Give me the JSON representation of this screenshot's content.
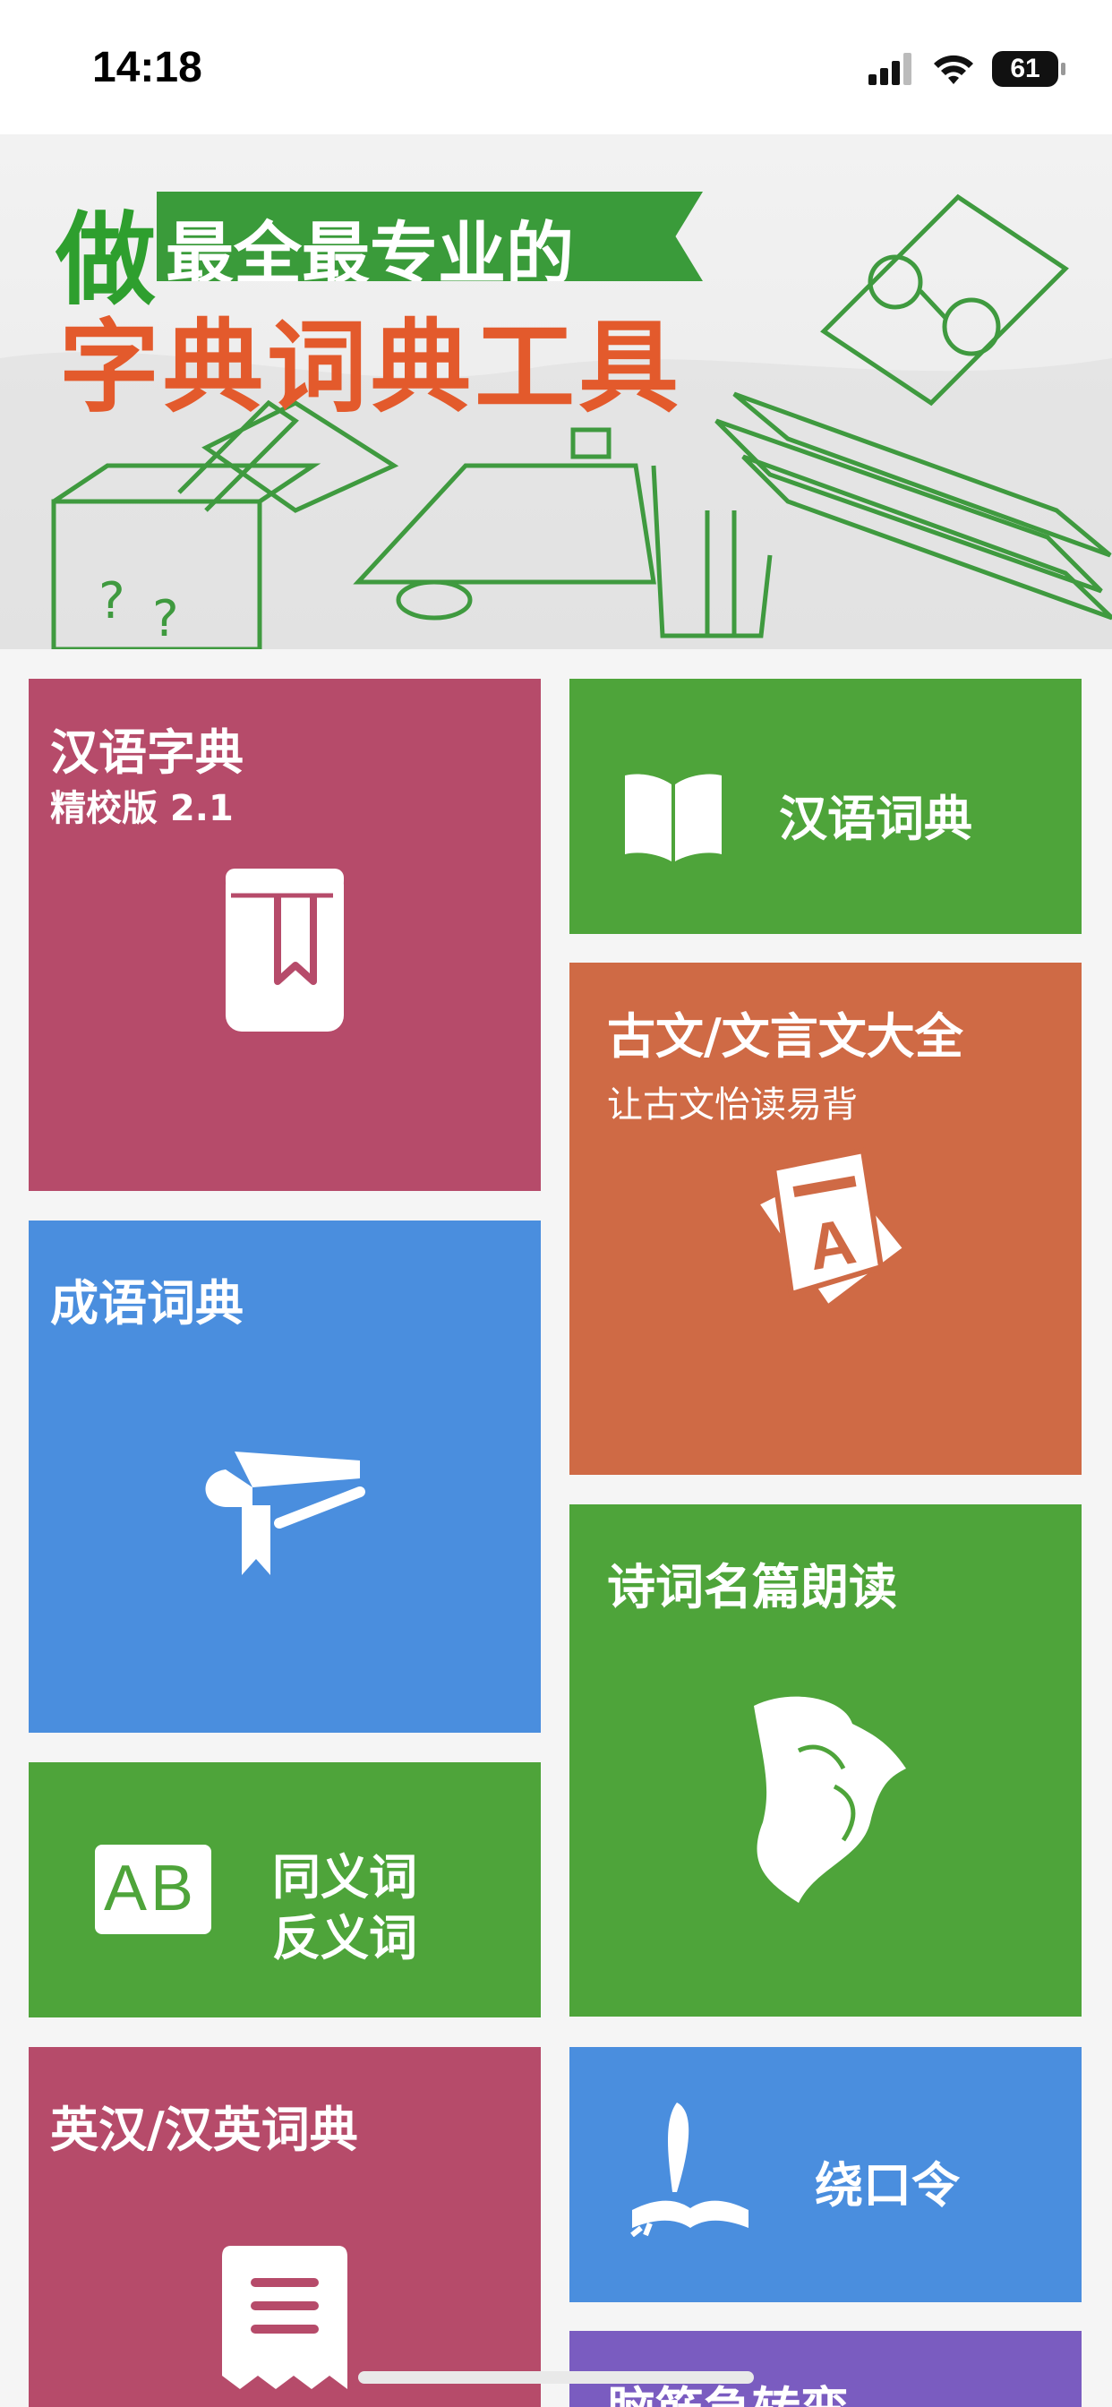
{
  "status_bar": {
    "time": "14:18",
    "battery": "61"
  },
  "banner": {
    "lead_char": "做",
    "ribbon_text": "最全最专业的",
    "title": "字典词典工具"
  },
  "tiles": {
    "hanyu_zidian": {
      "title": "汉语字典",
      "subtitle": "精校版 2.1",
      "icon": "bookmark-book-icon",
      "color": "#b64b6a"
    },
    "hanyu_cidian": {
      "title": "汉语词典",
      "icon": "open-book-icon",
      "color": "#4ea43a"
    },
    "guwen": {
      "title": "古文/文言文大全",
      "subtitle": "让古文怡读易背",
      "icon": "letter-a-book-icon",
      "color": "#cf6a45"
    },
    "chengyu": {
      "title": "成语词典",
      "icon": "graduation-book-icon",
      "color": "#4a8ede"
    },
    "shici": {
      "title": "诗词名篇朗读",
      "icon": "poet-icon",
      "color": "#4ea43a"
    },
    "tongyi": {
      "title_line1": "同义词",
      "title_line2": "反义词",
      "icon_text": "AB",
      "icon": "ab-book-icon",
      "color": "#4ea43a"
    },
    "yinghan": {
      "title": "英汉/汉英词典",
      "icon": "menu-bookmark-icon",
      "color": "#b64b6a"
    },
    "raokouling": {
      "title": "绕口令",
      "icon": "quill-book-icon",
      "color": "#4a8ede"
    },
    "naojin": {
      "title": "脑筋急转弯",
      "color": "#7a5cc0"
    }
  }
}
